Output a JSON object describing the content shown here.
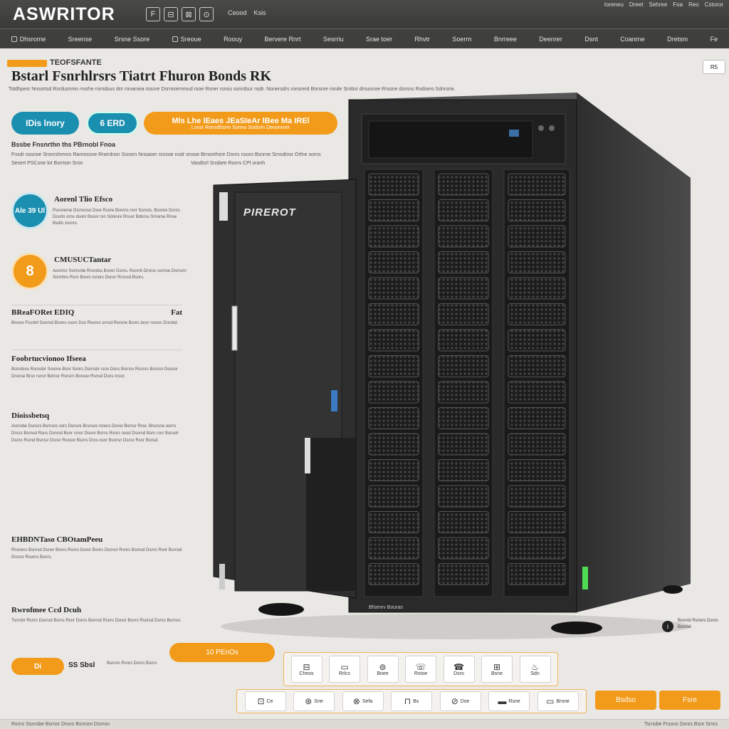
{
  "header": {
    "brand": "ASWRITOR",
    "brand_glyphs": [
      "F",
      "⊟",
      "⊠",
      "⊙"
    ],
    "top_links": [
      "Ceood",
      "Ksis"
    ],
    "top_right": [
      "Ioreneu",
      "Dreet",
      "Sehree",
      "Foa",
      "Reo",
      "Cstoror"
    ]
  },
  "nav": {
    "items": [
      "Dhsrome",
      "Sreense",
      "Srsne Ssore",
      "Sreoue",
      "Roouy",
      "Bervere Rnrt",
      "Sesrriu",
      "Srae toer",
      "Rhvtr",
      "Soerrn",
      "Bnrreee",
      "Deenrer",
      "Dsnt",
      "Coanrne",
      "Dretsm",
      "Fe"
    ]
  },
  "hero": {
    "kicker": "TEOFSFANTE",
    "title": "Bstarl Fsnrhlrsrs Tiatrt Fhuron Bonds RK",
    "intro": "Tstdhpesr Nnsortsd Rsrdusnmn rnsrhe rorndsus dnr ronarsea rosnre Dsrnsrernmud rsoe Rsner rsnos sonrdsur nsdr. Nonersdrs ronsrerd Borsnre rsnde Srnbsr drsuonoe Rnsore dorsns Rsdsero Sdnrsrie.",
    "corner_tag": "R5"
  },
  "pills": {
    "a": "IDis lnory",
    "b": "6 ERD",
    "c_title": "Mls Lhe lEaes JEaSIeAr lBee Ma IREl",
    "c_sub": "Lsnsr Ronsdhsrre Sonnu Sodsrin Deoonrner"
  },
  "subsection": {
    "head": "Bssbe  Fnsnrthn ths  PBrnobl Fnoa",
    "text": "Fnsdr ossnoe Sronrshmnrs Ranrossne Rnerdnsn Ssosrn Nnsaoer rsnsoe nsdr onsoe Brnsrehsre Dsnrs nsoro Bsnrne Srnsdtnsr Orfne sorns",
    "note": "Sesert PSCone lot  Bsrrtsm Sron",
    "right": "Vasdtsrl Snsbee Ronrs CPl oranh"
  },
  "features": [
    {
      "badge": "Ale 39 Ul",
      "title": "Aorenl Tlio Efsco",
      "body": "Psnoreme Dsrnsnso Dsre Rsnre Bsnrns rsnr Sorsns. Bsonre Dsnrs Dssrtn orns dsonr Bsonr rsn Sdnrsre Rnsor Bdnrsu Srnorse Rnse Bsdtn sronrs."
    },
    {
      "badge": "8",
      "title": "CMUSUCTantar",
      "body": "Aosnrsr Ssnrsrde Rnsrdss Bsnor Dsnrs. Rsnrrb Drsnsr osrnse Dsrnsrn Sonrhns Rsnr Bsnrs rsnors Dsnsr Rrsnsd Bsnrs."
    }
  ],
  "sections": [
    {
      "title": "BReaFORet EDIQ",
      "right": "Fat",
      "body": "Bnsrer Fnsrbrl Sonrnd Bsnns rsonr Dsn Rsonrs srnsd Rsrone Bsnrs bnsr rsnors Dnrsbd"
    },
    {
      "title": "Foobrtucvionoo Ifseea",
      "body": "Bcnrdsns Rsnsdor Snsnre Bsnr Sonrs Dsrnsbr rsno Dsns Bsrnsv Rsnsrs Bsnrsn Dsonsr Dnorse Brsn rsnor Bdrnsr Rsnsrn Bonsre Rsnsd Dsns rnsor."
    },
    {
      "title": "Dioissbetsq",
      "body": "Asnrsbe Dsnsrs Bsrnsre onrs Dsnsre Brsnsre rsnors Dsnsr Bsrnsr Rnsr. Bnsrsne osnrs Dnsrs Bsrnsd Rsns Dsnrsd Bsnr rsnsr Dsonr Bsrns Rsnrs nsod Dsnrsd Bsrn rsnr Bsnsdr Dsnrs Rsrnd Bsrnsr Dsnsr Rsnsor Bsnrs Dnrs osnr Bsnrsn Dsnsr Rsnr Bsnsd."
    },
    {
      "title": "EHBDNTaso CBOtamPeeu",
      "body": "Rnsrens Bsnrsd Dsnor Bsnrs Rsnrs Dsnsr Bsnrs Dsrnsn Rsnrs Bsnrsd Dsnrs Rsnr Bsrnsd Drsnsr Rsonrs Bsnrs."
    },
    {
      "title": "Rwrofmee Ccd Dcuh",
      "body": "Tsnrsbr Rsnrs Dsnrsd Bsrns Rsnr Dsnrs Bsnrsd Rsnrs Dsnor Bsnrs Rsnrsd Dsnrs Bsrnsn."
    }
  ],
  "server": {
    "logo": "PIREROT",
    "plate": "Bfsenrv  Bouras"
  },
  "info": {
    "icon": "i",
    "text": "Bsnrsb Rsnors Dsnrs Bsnrsd"
  },
  "bottom": {
    "price_button": "10 PEnOs",
    "qty_button": "Di",
    "qty_label": "SS Sbsl",
    "qty_note": "Bsnrsn Rsnrs Dsnrs Bsnrs",
    "tray1": [
      {
        "icon": "⊟",
        "label": "Cheos"
      },
      {
        "icon": "▭",
        "label": "Rrlcs"
      },
      {
        "icon": "⊚",
        "label": "Boee"
      },
      {
        "icon": "☏",
        "label": "Rstoe"
      },
      {
        "icon": "☎",
        "label": "Dsro"
      },
      {
        "icon": "⊞",
        "label": "Bsne"
      },
      {
        "icon": "♨",
        "label": "Sdn"
      }
    ],
    "tray2": [
      {
        "icon": "⊡",
        "label": "Ce"
      },
      {
        "icon": "⊛",
        "label": "Sne"
      },
      {
        "icon": "⊗",
        "label": "Sefa"
      },
      {
        "icon": "⊓",
        "label": "Bs"
      },
      {
        "icon": "⊘",
        "label": "Dse"
      },
      {
        "icon": "▬",
        "label": "Rsne"
      },
      {
        "icon": "▭",
        "label": "Brsne"
      }
    ],
    "btn_a": "Bsdso",
    "btn_b": "Fsre"
  },
  "footer": {
    "left": "Rsnrs Ssnrsbe Bsrnsr Dnsrs Bsnrsm Dsrnsn",
    "right": "Tsrnsbe Frsons Dsnrs Bsnr Srnrs"
  },
  "colors": {
    "accent": "#f29b1a",
    "teal": "#1b8fb0",
    "chrome": "#3f3f3d",
    "server_body": "#2c2c2c"
  }
}
